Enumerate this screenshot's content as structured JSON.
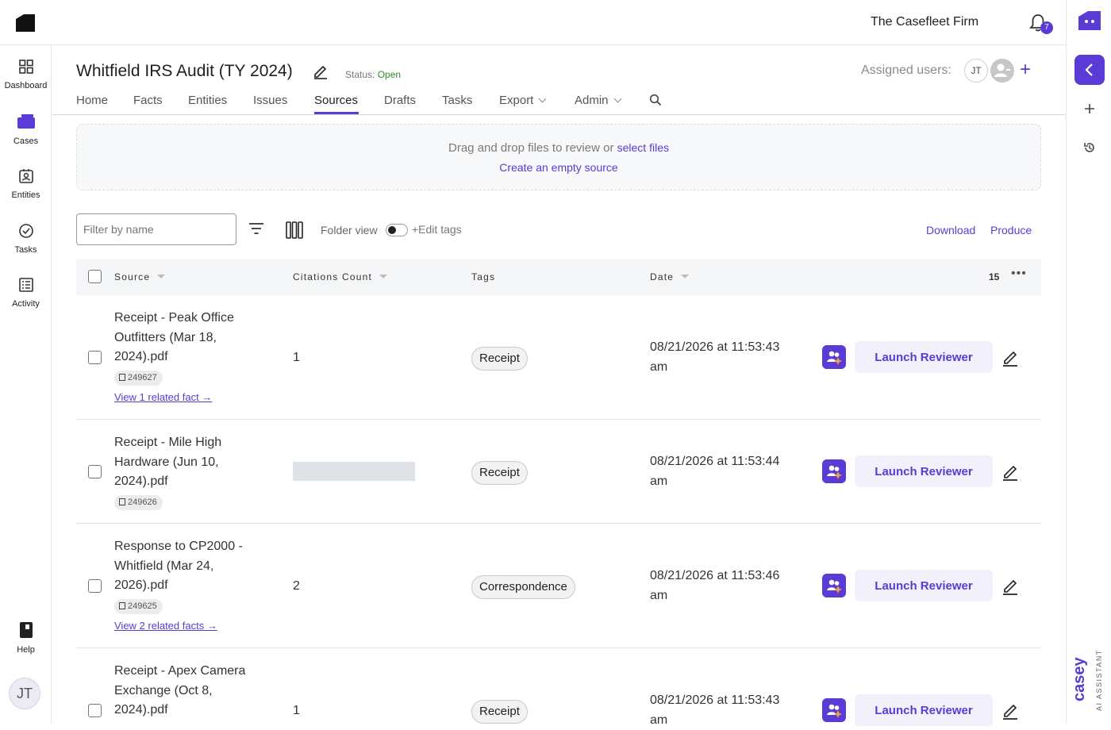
{
  "topbar": {
    "firm_name": "The Casefleet Firm",
    "notification_count": "7"
  },
  "sidebar": {
    "items": [
      {
        "label": "Dashboard",
        "icon": "grid-icon"
      },
      {
        "label": "Cases",
        "icon": "briefcase-icon"
      },
      {
        "label": "Entities",
        "icon": "contact-card-icon"
      },
      {
        "label": "Tasks",
        "icon": "check-circle-icon"
      },
      {
        "label": "Activity",
        "icon": "list-icon"
      }
    ],
    "help_label": "Help",
    "user_initials": "JT"
  },
  "case": {
    "title": "Whitfield IRS Audit (TY 2024)",
    "status_label": "Status:",
    "status_value": "Open",
    "assigned_label": "Assigned users:",
    "assigned_initials": "JT"
  },
  "tabs": [
    {
      "label": "Home"
    },
    {
      "label": "Facts"
    },
    {
      "label": "Entities"
    },
    {
      "label": "Issues"
    },
    {
      "label": "Sources",
      "active": true
    },
    {
      "label": "Drafts"
    },
    {
      "label": "Tasks"
    },
    {
      "label": "Export",
      "dropdown": true
    },
    {
      "label": "Admin",
      "dropdown": true
    }
  ],
  "dropzone": {
    "text": "Drag and drop files to review or",
    "select_link": "select files",
    "empty_source_link": "Create an empty source"
  },
  "toolbar": {
    "filter_placeholder": "Filter by name",
    "folder_view_label": "Folder view",
    "edit_tags_label": "+Edit tags",
    "download_label": "Download",
    "produce_label": "Produce"
  },
  "table": {
    "headers": {
      "source": "Source",
      "citations": "Citations Count",
      "tags": "Tags",
      "date": "Date"
    },
    "row_count": "15",
    "launch_label": "Launch Reviewer",
    "rows": [
      {
        "name": "Receipt - Peak Office Outfitters (Mar 18, 2024).pdf",
        "id": "249627",
        "related": "View 1 related fact →",
        "citations": "1",
        "tag": "Receipt",
        "date": "08/21/2026 at 11:53:43 am"
      },
      {
        "name": "Receipt - Mile High Hardware (Jun 10, 2024).pdf",
        "id": "249626",
        "related": "",
        "citations": "",
        "tag": "Receipt",
        "date": "08/21/2026 at 11:53:44 am"
      },
      {
        "name": "Response to CP2000 - Whitfield (Mar 24, 2026).pdf",
        "id": "249625",
        "related": "View 2 related facts →",
        "citations": "2",
        "tag": "Correspondence",
        "date": "08/21/2026 at 11:53:46 am"
      },
      {
        "name": "Receipt - Apex Camera Exchange (Oct 8, 2024).pdf",
        "id": "",
        "related": "",
        "citations": "1",
        "tag": "Receipt",
        "date": "08/21/2026 at 11:53:43 am"
      }
    ]
  },
  "rail": {
    "brand": "casey",
    "brand_sub": "AI ASSISTANT"
  },
  "colors": {
    "accent": "#5a3bd6",
    "status_open": "#2e8b2e"
  }
}
